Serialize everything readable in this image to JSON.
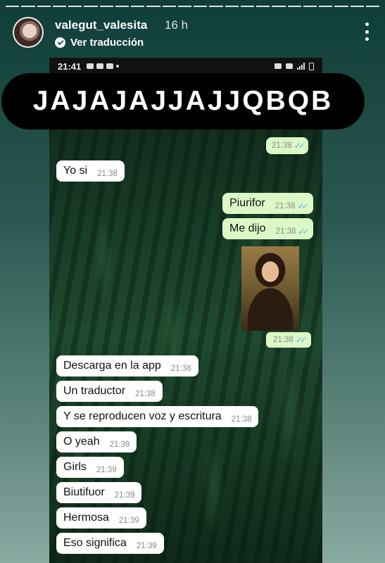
{
  "story": {
    "username": "valegut_valesita",
    "time_ago": "16 h",
    "translate_label": "Ver traducción",
    "more_icon": "more-vertical-icon"
  },
  "phone": {
    "status_time": "21:41"
  },
  "banner_text": "JAJAJAJJAJJQBQB",
  "messages": [
    {
      "dir": "out",
      "text": "",
      "time": "21:38"
    },
    {
      "dir": "in",
      "text": "Yo si",
      "time": "21:38"
    },
    {
      "dir": "out",
      "text": "Piurifor",
      "time": "21:38"
    },
    {
      "dir": "out",
      "text": "Me dijo",
      "time": "21:38"
    },
    {
      "dir": "out",
      "text": "",
      "time": "21:38",
      "image": "mona-lisa-meme"
    },
    {
      "dir": "in",
      "text": "Descarga en la app",
      "time": "21:38"
    },
    {
      "dir": "in",
      "text": "Un traductor",
      "time": "21:38"
    },
    {
      "dir": "in",
      "text": "Y se reproducen voz y escritura",
      "time": "21:38"
    },
    {
      "dir": "in",
      "text": "O yeah",
      "time": "21:39"
    },
    {
      "dir": "in",
      "text": "Girls",
      "time": "21:39"
    },
    {
      "dir": "in",
      "text": "Biutifuor",
      "time": "21:39"
    },
    {
      "dir": "in",
      "text": "Hermosa",
      "time": "21:39"
    },
    {
      "dir": "in",
      "text": "Eso significa",
      "time": "21:39"
    }
  ],
  "colors": {
    "incoming_bubble": "#ffffff",
    "outgoing_bubble": "#dcf8c6",
    "read_tick": "#4fb6ec"
  }
}
